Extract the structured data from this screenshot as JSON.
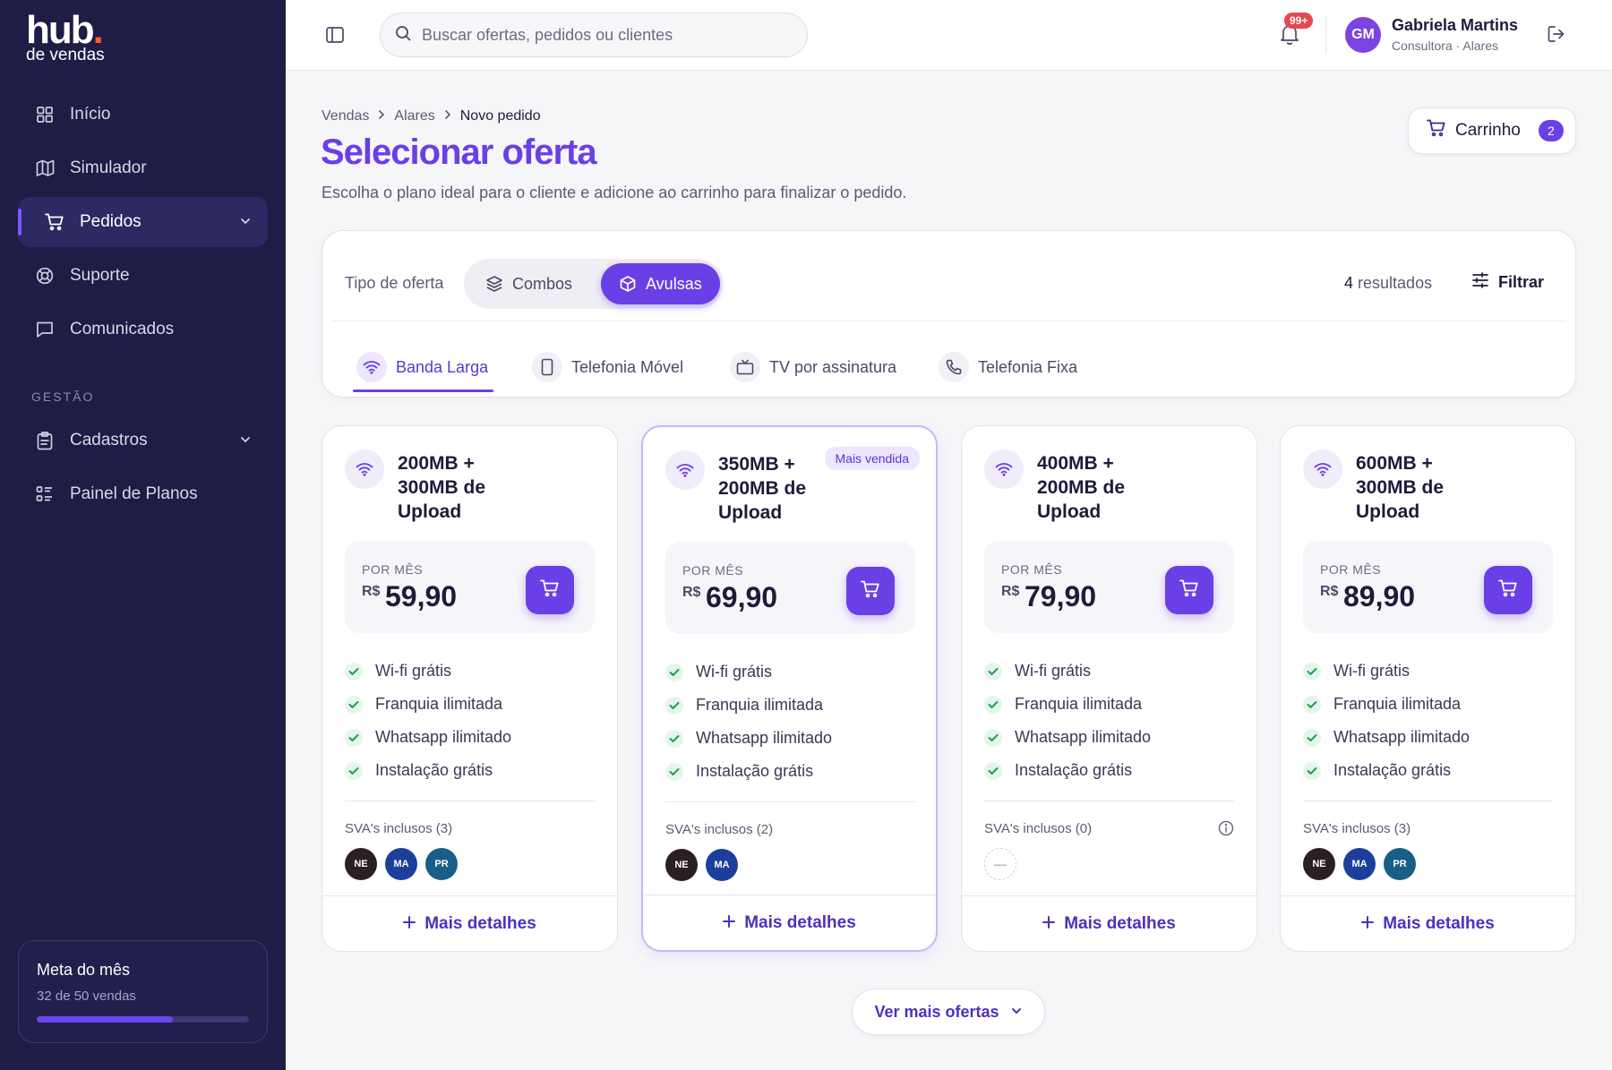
{
  "brand": {
    "logo_main": "hub",
    "logo_dot": ".",
    "logo_sub": "de vendas",
    "accent": "#6a3fe6",
    "dot_color": "#ff5a2c"
  },
  "sidebar": {
    "items": [
      {
        "label": "Início",
        "icon": "grid-icon"
      },
      {
        "label": "Simulador",
        "icon": "map-icon"
      },
      {
        "label": "Pedidos",
        "icon": "cart-icon",
        "active": true
      },
      {
        "label": "Suporte",
        "icon": "lifebuoy-icon"
      },
      {
        "label": "Comunicados",
        "icon": "message-icon"
      }
    ],
    "section_label": "GESTÃO",
    "gestao_items": [
      {
        "label": "Cadastros",
        "icon": "clipboard-icon"
      },
      {
        "label": "Painel de Planos",
        "icon": "list-icon"
      }
    ],
    "goal": {
      "title": "Meta do mês",
      "subtitle": "32 de 50 vendas",
      "progress": 0.64
    }
  },
  "topbar": {
    "search_placeholder": "Buscar ofertas, pedidos ou clientes",
    "notif_badge": "99+",
    "user": {
      "initials": "GM",
      "name": "Gabriela Martins",
      "role": "Consultora · Alares"
    }
  },
  "header": {
    "breadcrumb": [
      "Vendas",
      "Alares",
      "Novo pedido"
    ],
    "title": "Selecionar oferta",
    "subtitle": "Escolha o plano ideal para o cliente e adicione ao carrinho para finalizar o pedido.",
    "cart_label": "Carrinho",
    "cart_count": "2"
  },
  "filters": {
    "tipo_label": "Tipo de oferta",
    "combos_label": "Combos",
    "avulsas_label": "Avulsas",
    "results_count": "4",
    "results_label": "resultados",
    "filter_label": "Filtrar",
    "categories": [
      {
        "label": "Banda Larga",
        "active": true
      },
      {
        "label": "Telefonia Móvel"
      },
      {
        "label": "TV por assinatura"
      },
      {
        "label": "Telefonia Fixa"
      }
    ]
  },
  "offers": [
    {
      "name": "200MB + 300MB de Upload",
      "per_month": "POR MÊS",
      "currency": "R$",
      "price": "59,90",
      "features": [
        "Wi-fi grátis",
        "Franquia ilimitada",
        "Whatsapp ilimitado",
        "Instalação grátis"
      ],
      "sva_label": "SVA's inclusos (3)",
      "svas": [
        "NE",
        "MA",
        "PR"
      ],
      "details": "Mais detalhes"
    },
    {
      "name": "350MB + 200MB de Upload",
      "tag": "Mais vendida",
      "per_month": "POR MÊS",
      "currency": "R$",
      "price": "69,90",
      "features": [
        "Wi-fi grátis",
        "Franquia ilimitada",
        "Whatsapp ilimitado",
        "Instalação grátis"
      ],
      "sva_label": "SVA's inclusos (2)",
      "svas": [
        "NE",
        "MA"
      ],
      "details": "Mais detalhes"
    },
    {
      "name": "400MB + 200MB de Upload",
      "per_month": "POR MÊS",
      "currency": "R$",
      "price": "79,90",
      "features": [
        "Wi-fi grátis",
        "Franquia ilimitada",
        "Whatsapp ilimitado",
        "Instalação grátis"
      ],
      "sva_label": "SVA's inclusos (0)",
      "svas": [],
      "sva_empty": "—",
      "details": "Mais detalhes"
    },
    {
      "name": "600MB + 300MB de Upload",
      "per_month": "POR MÊS",
      "currency": "R$",
      "price": "89,90",
      "features": [
        "Wi-fi grátis",
        "Franquia ilimitada",
        "Whatsapp ilimitado",
        "Instalação grátis"
      ],
      "sva_label": "SVA's inclusos (3)",
      "svas": [
        "NE",
        "MA",
        "PR"
      ],
      "details": "Mais detalhes"
    }
  ],
  "more_offers_label": "Ver mais ofertas"
}
